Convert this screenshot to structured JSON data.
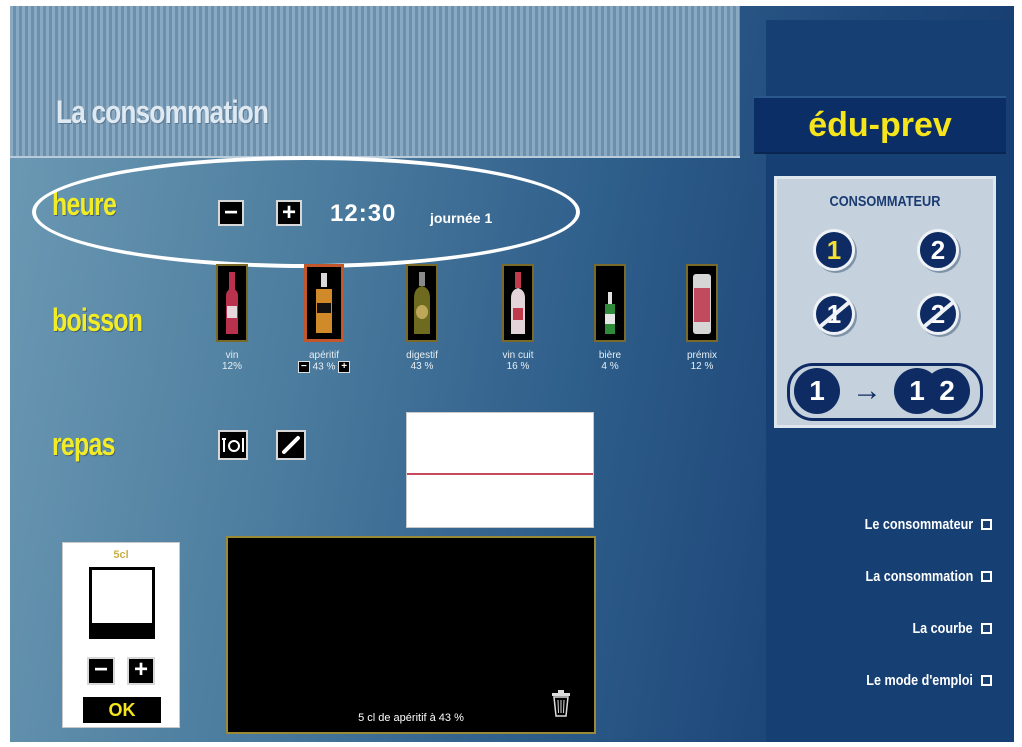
{
  "header": {
    "title": "La consommation"
  },
  "brand": {
    "name": "édu-prev"
  },
  "heure": {
    "label": "heure",
    "minus": "−",
    "plus": "+",
    "time": "12:30",
    "day": "journée 1"
  },
  "boisson": {
    "label": "boisson",
    "items": [
      {
        "name": "vin",
        "percent": "12%",
        "icon": "wine-bottle-icon",
        "color": "#b8324e"
      },
      {
        "name": "apéritif",
        "percent": "43 %",
        "icon": "aperitif-bottle-icon",
        "color": "#d08a2a",
        "selected": true
      },
      {
        "name": "digestif",
        "percent": "43 %",
        "icon": "digestif-bottle-icon",
        "color": "#6e6a20"
      },
      {
        "name": "vin cuit",
        "percent": "16 %",
        "icon": "vin-cuit-bottle-icon",
        "color": "#d7c3cf"
      },
      {
        "name": "bière",
        "percent": "4 %",
        "icon": "beer-bottle-icon",
        "color": "#2f8a3a"
      },
      {
        "name": "prémix",
        "percent": "12 %",
        "icon": "premix-can-icon",
        "color": "#d6d6d6"
      }
    ]
  },
  "repas": {
    "label": "repas"
  },
  "glass": {
    "volume_label": "5cl",
    "fill_fraction": 0.18,
    "minus": "−",
    "plus": "+",
    "ok_label": "OK"
  },
  "log": {
    "text": "5 cl de apéritif à 43 %"
  },
  "consumer_panel": {
    "title": "CONSOMMATEUR",
    "badges": [
      "1",
      "2",
      "1",
      "2"
    ],
    "switch_from": "1",
    "switch_arrow": "→",
    "switch_to": [
      "1",
      "2"
    ]
  },
  "nav": [
    {
      "label": "Le consommateur"
    },
    {
      "label": "La consommation"
    },
    {
      "label": "La courbe"
    },
    {
      "label": "Le mode d'emploi"
    }
  ],
  "colors": {
    "accent_yellow": "#f1ec25",
    "brand_navy": "#0c2e66",
    "curve_red": "#c44a5c"
  }
}
